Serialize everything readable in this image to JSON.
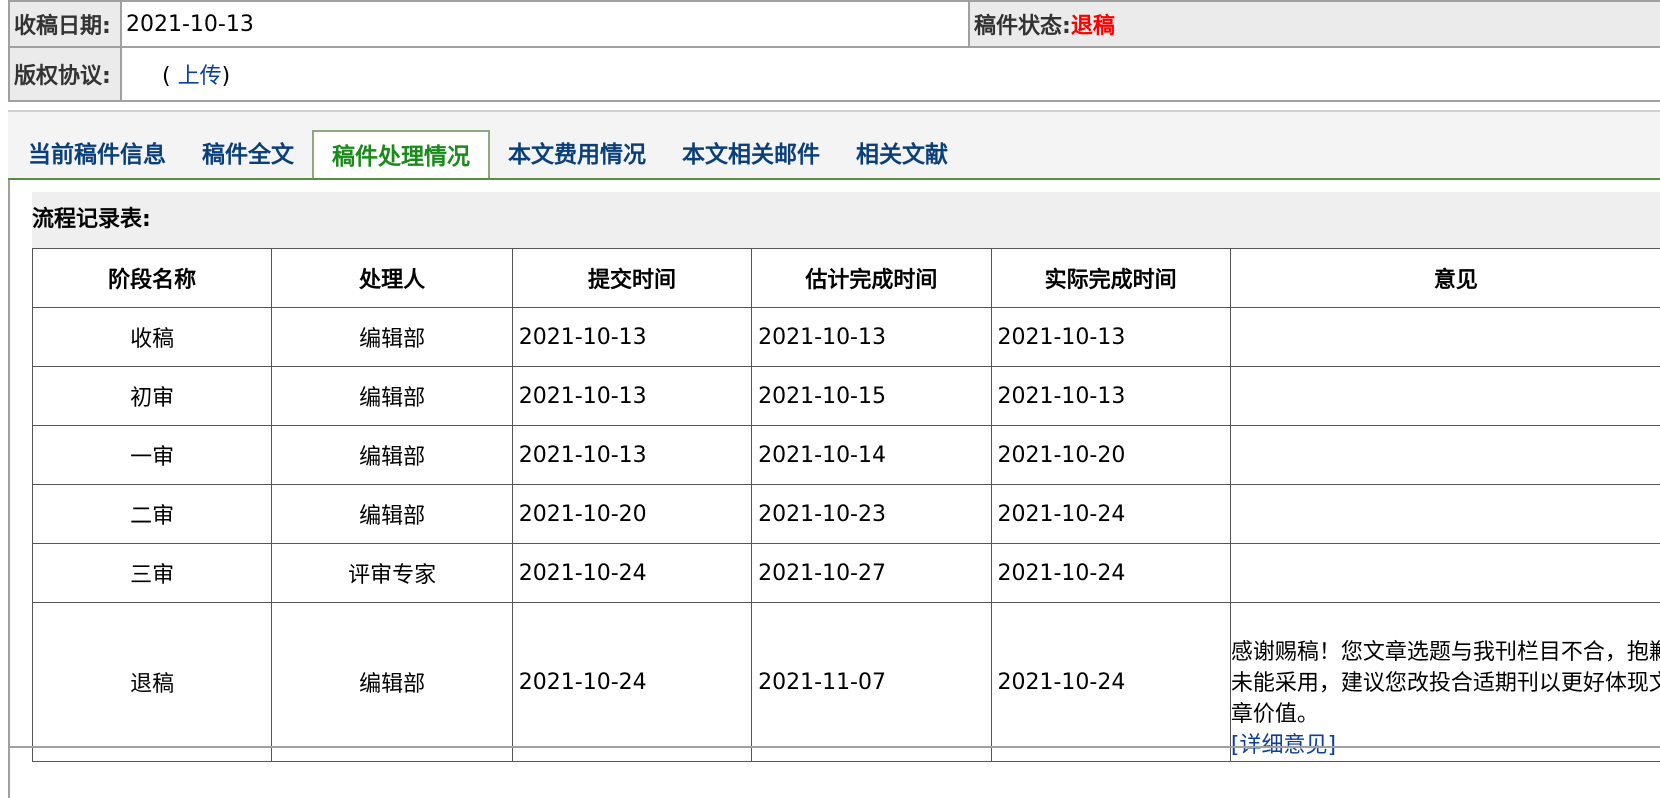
{
  "info": {
    "received_label": "收稿日期:",
    "received_value": "2021-10-13",
    "status_label": "稿件状态:",
    "status_value": "退稿",
    "copyright_label": "版权协议:",
    "upload_open": "(",
    "upload_link": "上传",
    "upload_close": ")"
  },
  "tabs": [
    {
      "label": "当前稿件信息"
    },
    {
      "label": "稿件全文"
    },
    {
      "label": "稿件处理情况"
    },
    {
      "label": "本文费用情况"
    },
    {
      "label": "本文相关邮件"
    },
    {
      "label": "相关文献"
    }
  ],
  "process": {
    "title": "流程记录表:",
    "headers": [
      "阶段名称",
      "处理人",
      "提交时间",
      "估计完成时间",
      "实际完成时间",
      "意见"
    ],
    "rows": [
      [
        "收稿",
        "编辑部",
        "2021-10-13",
        "2021-10-13",
        "2021-10-13",
        ""
      ],
      [
        "初审",
        "编辑部",
        "2021-10-13",
        "2021-10-15",
        "2021-10-13",
        ""
      ],
      [
        "一审",
        "编辑部",
        "2021-10-13",
        "2021-10-14",
        "2021-10-20",
        ""
      ],
      [
        "二审",
        "编辑部",
        "2021-10-20",
        "2021-10-23",
        "2021-10-24",
        ""
      ],
      [
        "三审",
        "评审专家",
        "2021-10-24",
        "2021-10-27",
        "2021-10-24",
        ""
      ],
      [
        "退稿",
        "编辑部",
        "2021-10-24",
        "2021-11-07",
        "2021-10-24",
        "感谢赐稿！您文章选题与我刊栏目不合，抱歉未能采用，建议您改投合适期刊以更好体现文章价值。"
      ]
    ],
    "detail_link": "[详细意见]"
  },
  "colors": {
    "status_red": "#ff0000",
    "tab_blue": "#0b3f7a",
    "tab_active_green": "#1a8a1a",
    "link_blue": "#0b3f9a"
  }
}
